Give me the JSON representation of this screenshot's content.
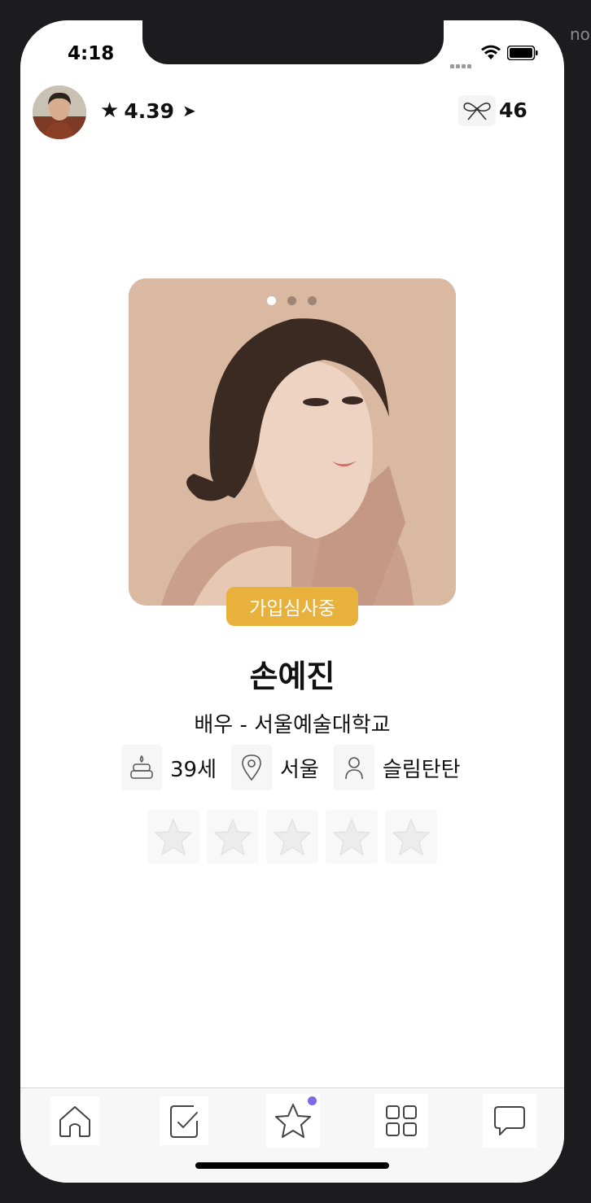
{
  "status_bar": {
    "time": "4:18"
  },
  "edge_text": "no",
  "header": {
    "rating": "4.39",
    "star_glyph": "★",
    "arrow_glyph": "➤",
    "bow_count": "46",
    "avatar_icon": "user-avatar",
    "bow_icon": "ribbon-bow-icon"
  },
  "profile": {
    "status_badge": "가입심사중",
    "name": "손예진",
    "job": "배우 - 서울예술대학교",
    "age": "39세",
    "location": "서울",
    "body_type": "슬림탄탄",
    "photo_count": 3,
    "active_photo_index": 0,
    "star_rating_slots": 5,
    "star_rating_value": 0
  },
  "colors": {
    "badge": "#e8b13c",
    "tab_dot": "#7b6be0"
  },
  "tabs": [
    {
      "icon": "home-icon"
    },
    {
      "icon": "checklist-icon"
    },
    {
      "icon": "star-icon",
      "has_dot": true
    },
    {
      "icon": "grid-icon"
    },
    {
      "icon": "chat-icon"
    }
  ]
}
